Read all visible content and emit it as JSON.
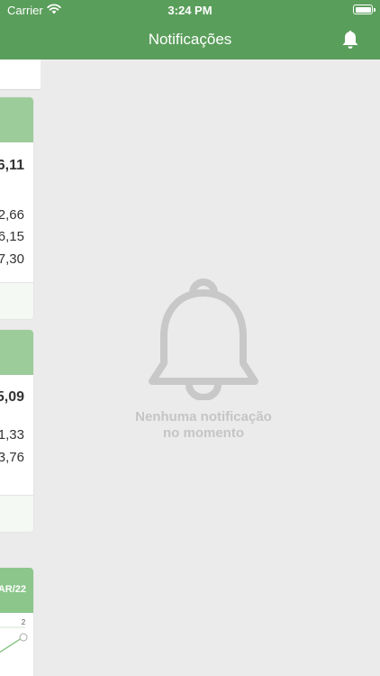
{
  "status_bar": {
    "carrier": "Carrier",
    "time": "3:24 PM"
  },
  "header": {
    "title": "Notificações",
    "bell_icon": "bell-icon"
  },
  "background_cards": [
    {
      "big_value": "6,11",
      "values": [
        "2,66",
        "6,15",
        "7,30"
      ]
    },
    {
      "big_value": "5,09",
      "values": [
        "1,33",
        "3,76"
      ]
    },
    {
      "header_label": "AR/22",
      "chart_label": "2"
    }
  ],
  "empty_state": {
    "icon": "bell-outline-icon",
    "line1": "Nenhuma notificação",
    "line2": "no momento"
  },
  "colors": {
    "primary": "#5a9e5b",
    "card_header": "#9dcc9b",
    "muted_text": "#c5c5c5"
  }
}
